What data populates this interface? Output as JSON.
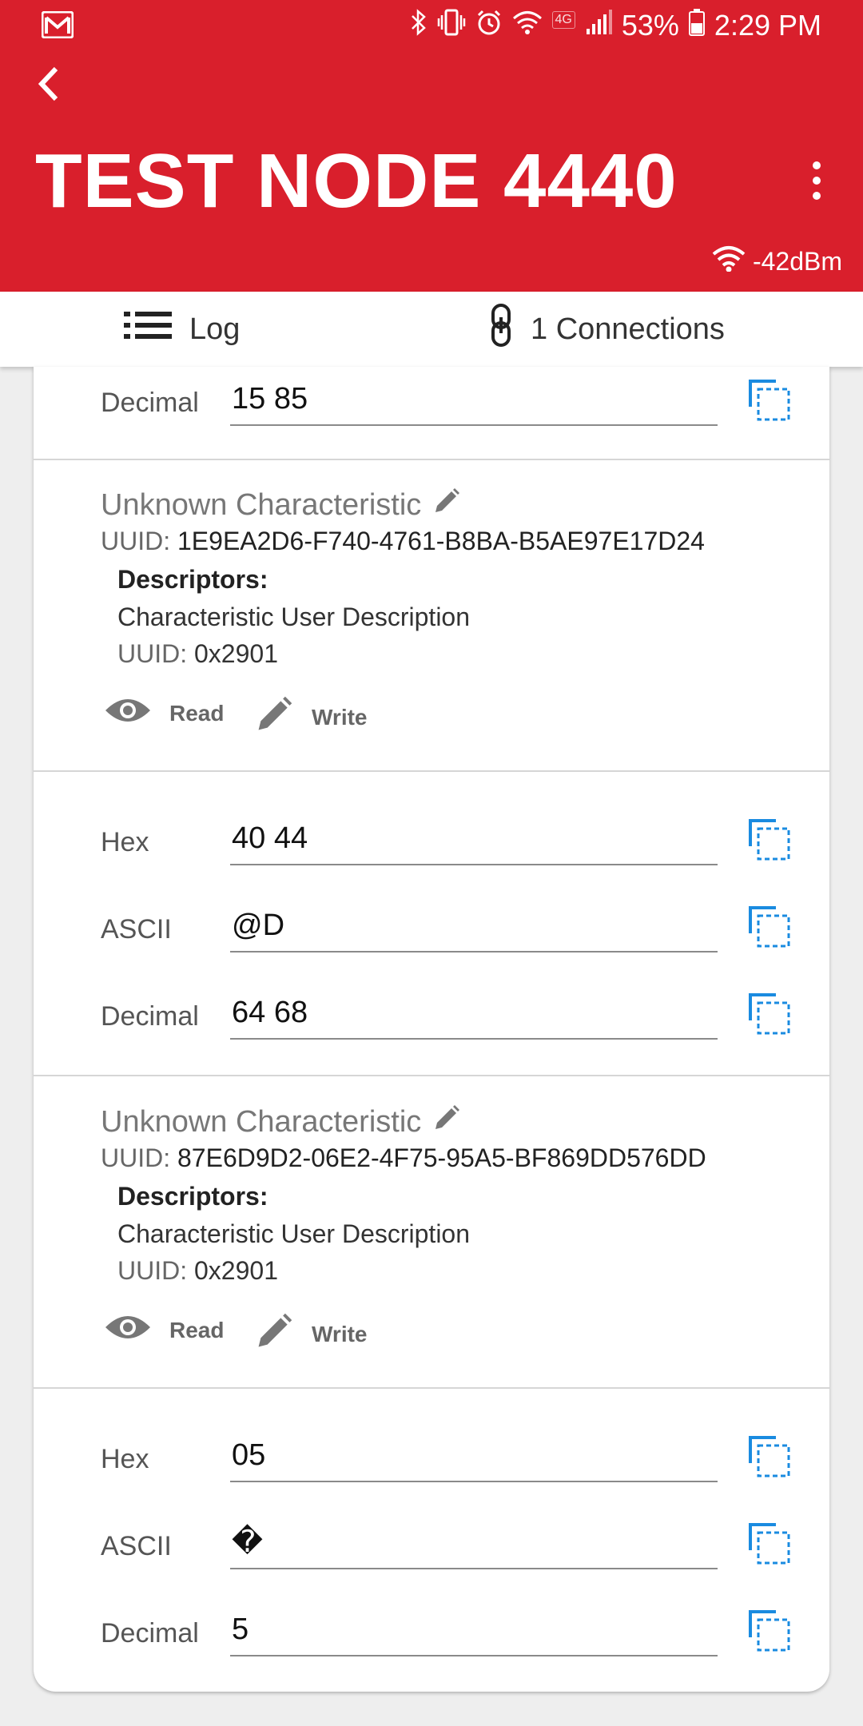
{
  "status_bar": {
    "battery": "53%",
    "time": "2:29 PM",
    "network_badge": "4G"
  },
  "header": {
    "title": "TEST NODE 4440",
    "rssi": "-42dBm"
  },
  "tabs": {
    "log_label": "Log",
    "connections_label": "1 Connections"
  },
  "rows": {
    "top_decimal": {
      "label": "Decimal",
      "value": "15 85"
    },
    "c1_hex": {
      "label": "Hex",
      "value": "40 44"
    },
    "c1_ascii": {
      "label": "ASCII",
      "value": "@D"
    },
    "c1_decimal": {
      "label": "Decimal",
      "value": "64 68"
    },
    "c2_hex": {
      "label": "Hex",
      "value": "05"
    },
    "c2_ascii": {
      "label": "ASCII",
      "value": "�"
    },
    "c2_decimal": {
      "label": "Decimal",
      "value": "5"
    }
  },
  "characteristics": [
    {
      "name": "Unknown Characteristic",
      "uuid_label": "UUID:",
      "uuid": "1E9EA2D6-F740-4761-B8BA-B5AE97E17D24",
      "descriptors_title": "Descriptors:",
      "descriptor_name": "Characteristic User Description",
      "descriptor_uuid_label": "UUID:",
      "descriptor_uuid": "0x2901",
      "read_label": "Read",
      "write_label": "Write"
    },
    {
      "name": "Unknown Characteristic",
      "uuid_label": "UUID:",
      "uuid": "87E6D9D2-06E2-4F75-95A5-BF869DD576DD",
      "descriptors_title": "Descriptors:",
      "descriptor_name": "Characteristic User Description",
      "descriptor_uuid_label": "UUID:",
      "descriptor_uuid": "0x2901",
      "read_label": "Read",
      "write_label": "Write"
    }
  ],
  "colors": {
    "brand": "#d91f2c",
    "copy_icon": "#1a8be0"
  },
  "icons": [
    "gmail-icon",
    "bluetooth-icon",
    "vibrate-icon",
    "alarm-icon",
    "wifi-icon",
    "signal-icon",
    "battery-icon",
    "back-arrow-icon",
    "more-vert-icon",
    "list-icon",
    "link-icon",
    "pencil-icon",
    "eye-icon",
    "copy-icon"
  ]
}
